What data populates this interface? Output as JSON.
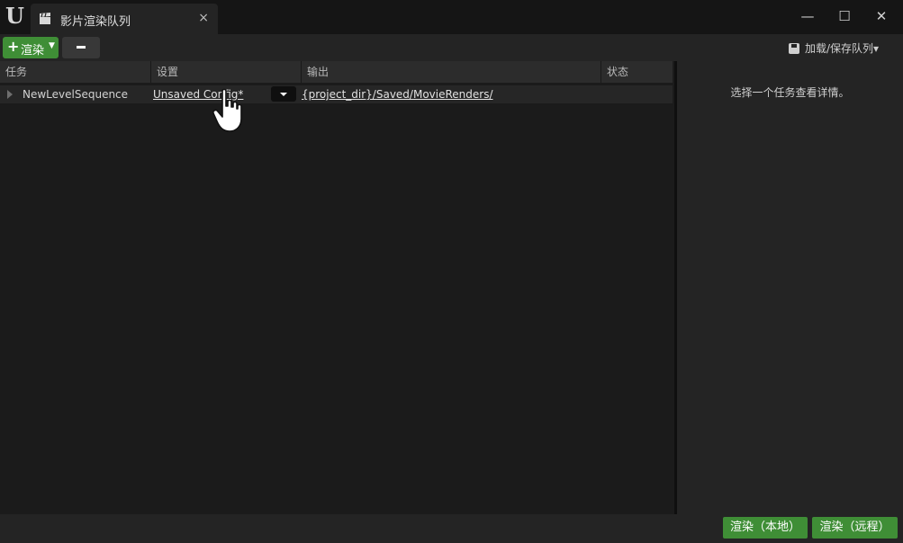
{
  "window": {
    "tab_title": "影片渲染队列",
    "tab_close": "×",
    "minimize": "—",
    "maximize": "☐",
    "close": "✕"
  },
  "toolbar": {
    "render_plus": "+",
    "render_label": "渲染",
    "render_caret": "▼",
    "load_save_label": "加载/保存队列▾"
  },
  "table": {
    "columns": [
      "任务",
      "设置",
      "输出",
      "状态"
    ],
    "rows": [
      {
        "job": "NewLevelSequence",
        "settings": "Unsaved Config*",
        "output": "{project_dir}/Saved/MovieRenders/",
        "status": ""
      }
    ]
  },
  "details": {
    "hint": "选择一个任务查看详情。"
  },
  "bottom": {
    "render_local": "渲染（本地）",
    "render_remote": "渲染（远程）"
  },
  "icons": {
    "app_logo": "unreal-logo",
    "tab_icon": "clapperboard-icon",
    "save_icon": "floppy-disk-icon",
    "cursor": "hand-pointer-cursor"
  },
  "colors": {
    "accent_green": "#3f8e36",
    "panel_bg": "#1b1b1b",
    "right_panel_bg": "#242424"
  }
}
